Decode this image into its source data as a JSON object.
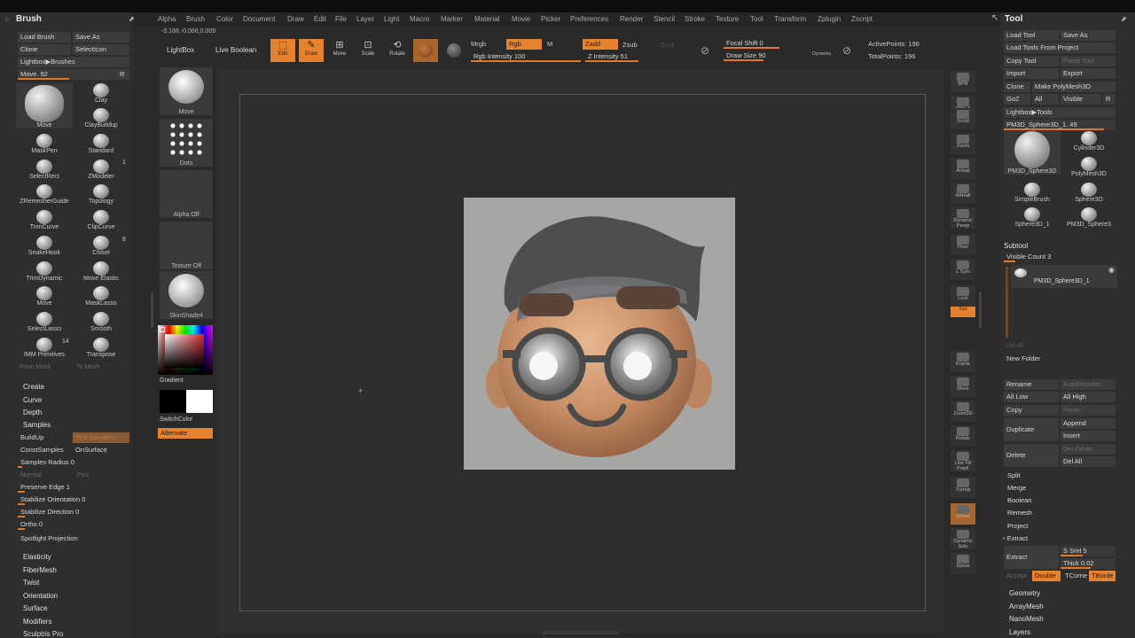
{
  "menu": [
    "Alpha",
    "Brush",
    "Color",
    "Document",
    "Draw",
    "Edit",
    "File",
    "Layer",
    "Light",
    "Macro",
    "Marker",
    "Material",
    "Movie",
    "Picker",
    "Preferences",
    "Render",
    "Stencil",
    "Stroke",
    "Texture",
    "Tool",
    "Transform",
    "Zplugin",
    "Zscript"
  ],
  "coords": "-0.186,-0.066,0.009",
  "brush_panel": {
    "title": "Brush",
    "load_brush": "Load Brush",
    "save_as": "Save As",
    "clone": "Clone",
    "select_icon": "SelectIcon",
    "lightbox_brushes": "Lightbox▶Brushes",
    "move_slider": "Move. 92",
    "r": "R",
    "brushes": [
      {
        "label": "Move"
      },
      {
        "label": "Clay"
      },
      {
        "label": "ClayBuildup"
      },
      {
        "label": "MaskPen"
      },
      {
        "label": "Standard"
      },
      {
        "label": "SelectRect"
      },
      {
        "label": "ZModeler"
      },
      {
        "label": "ZRemesherGuide"
      },
      {
        "label": "Topology"
      },
      {
        "label": "TrimCurve"
      },
      {
        "label": "ClipCurve"
      },
      {
        "label": "SnakeHook"
      },
      {
        "label": "Chisel"
      },
      {
        "label": "TrimDynamic"
      },
      {
        "label": "Move Elastic"
      },
      {
        "label": "Move"
      },
      {
        "label": "MaskLasso"
      },
      {
        "label": "SelectLasso"
      },
      {
        "label": "Smooth"
      },
      {
        "label": "IMM Primitives"
      },
      {
        "label": "Transpose"
      }
    ],
    "badge_1": "1",
    "badge_8": "8",
    "badge_14": "14",
    "from_mesh": "From Mesh",
    "to_mesh": "To Mesh",
    "create": "Create",
    "curve": "Curve",
    "depth": "Depth",
    "samples": "Samples",
    "build_up": "BuildUp",
    "test_samples": "Test Samples",
    "const_samples": "ConstSamples",
    "on_surface": "OnSurface",
    "samples_radius": "Samples Radius 0",
    "normal": "Normal",
    "pos": "Pos",
    "preserve_edge": "Preserve Edge 1",
    "stab_orient": "Stabilize Orientation 0",
    "stab_dir": "Stabilize Direction 0",
    "ortho": "Ortho 0",
    "spotlight": "Spotlight Projection",
    "bottom_items": [
      "Elasticity",
      "FiberMesh",
      "Twist",
      "Orientation",
      "Surface",
      "Modifiers",
      "Sculptris Pro"
    ]
  },
  "shelf": {
    "lightbox": "LightBox",
    "live_boolean": "Live Boolean",
    "edit": "Edit",
    "draw": "Draw",
    "move": "Move",
    "scale": "Scale",
    "rotate": "Rotate",
    "mrgb": "Mrgb",
    "rgb": "Rgb",
    "m": "M",
    "rgb_intensity": "Rgb Intensity 100",
    "zadd": "Zadd",
    "zsub": "Zsub",
    "zcut": "Zcut",
    "z_intensity": "Z Intensity 51",
    "focal_shift": "Focal Shift 0",
    "draw_size": "Draw Size 90",
    "dynamic": "Dynamic",
    "active_points": "ActivePoints: 196",
    "total_points": "TotalPoints: 196",
    "left_tools": [
      {
        "label": "Move"
      },
      {
        "label": "Dots"
      },
      {
        "label": "Alpha Off"
      },
      {
        "label": "Texture Off"
      },
      {
        "label": "SkinShade4"
      }
    ],
    "gradient": "Gradient",
    "switch_color": "SwitchColor",
    "alternate": "Alternate"
  },
  "right_shelf": [
    "BPR",
    "SPix 3",
    "Scroll",
    "Zoom",
    "Actual",
    "AAHalf",
    "Dynamic Persp",
    "Floor",
    "L.Sym",
    "Lock",
    "Xyz",
    "",
    "",
    "Frame",
    "Move",
    "Zoom3D",
    "Rotate",
    "Line Fill PolyF",
    "Transp",
    "Ghost",
    "Dynamic Solo",
    "Xpose"
  ],
  "tool_panel": {
    "title": "Tool",
    "load_tool": "Load Tool",
    "save_as": "Save As",
    "load_from_project": "Load Tools From Project",
    "copy_tool": "Copy Tool",
    "paste_tool": "Paste Tool",
    "import": "Import",
    "export": "Export",
    "clone": "Clone",
    "make_polymesh": "Make PolyMesh3D",
    "goz": "GoZ",
    "all": "All",
    "visible": "Visible",
    "r": "R",
    "lightbox_tools": "Lightbox▶Tools",
    "pm3d_slider": "PM3D_Sphere3D_1. 49",
    "tools": [
      {
        "label": "PM3D_Sphere3D"
      },
      {
        "label": "Cylinder3D"
      },
      {
        "label": "PolyMesh3D"
      },
      {
        "label": "SimpleBrush"
      },
      {
        "label": "Sphere3D"
      },
      {
        "label": "Sphere3D_1"
      },
      {
        "label": "PM3D_Sphere3"
      }
    ],
    "subtool": "Subtool",
    "visible_count": "Visible Count 3",
    "subtool_item": "PM3D_Sphere3D_1",
    "list_all": "List All",
    "new_folder": "New Folder",
    "rename": "Rename",
    "auto_reorder": "AutoReorder",
    "all_low": "All Low",
    "all_high": "All High",
    "copy": "Copy",
    "paste": "Paste",
    "duplicate": "Duplicate",
    "append": "Append",
    "insert": "Insert",
    "delete": "Delete",
    "del_other": "Del Other",
    "del_all": "Del All",
    "split": "Split",
    "merge": "Merge",
    "boolean": "Boolean",
    "remesh": "Remesh",
    "project": "Project",
    "extract_header": "Extract",
    "extract": "Extract",
    "s_smt": "S Smt 5",
    "thick": "Thick 0.02",
    "accept": "Accept",
    "double": "Double",
    "tcorne": "TCorne",
    "tborde": "TBorde",
    "bottom_items": [
      "Geometry",
      "ArrayMesh",
      "NanoMesh",
      "Layers"
    ]
  },
  "colors": {
    "accent": "#e6822e",
    "panel": "#2e2e2e",
    "canvas": "#303030"
  }
}
